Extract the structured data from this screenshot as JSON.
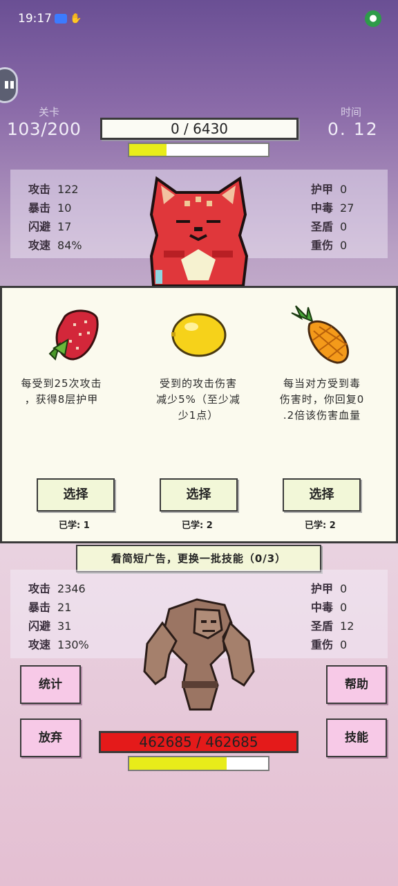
{
  "status_bar": {
    "time": "19:17"
  },
  "level": {
    "label": "关卡",
    "value": "103/200"
  },
  "time_display": {
    "label": "时间",
    "value": "0. 12"
  },
  "enemy": {
    "hp_text": "0  /  6430",
    "bar_fraction": 0.27,
    "stats_left": [
      {
        "label": "攻击",
        "value": "122"
      },
      {
        "label": "暴击",
        "value": "10"
      },
      {
        "label": "闪避",
        "value": "17"
      },
      {
        "label": "攻速",
        "value": "84%"
      }
    ],
    "stats_right": [
      {
        "label": "护甲",
        "value": "0"
      },
      {
        "label": "中毒",
        "value": "27"
      },
      {
        "label": "圣盾",
        "value": "0"
      },
      {
        "label": "重伤",
        "value": "0"
      }
    ]
  },
  "skills": [
    {
      "icon": "strawberry-icon",
      "desc_lines": [
        "每受到25次攻击",
        "，获得8层护甲"
      ],
      "button": "选择",
      "learned": "已学: 1"
    },
    {
      "icon": "lemon-icon",
      "desc_lines": [
        "受到的攻击伤害",
        "减少5%（至少减",
        "少1点）"
      ],
      "button": "选择",
      "learned": "已学: 2"
    },
    {
      "icon": "pineapple-icon",
      "desc_lines": [
        "每当对方受到毒",
        "伤害时，你回复0",
        ".2倍该伤害血量"
      ],
      "button": "选择",
      "learned": "已学: 2"
    }
  ],
  "reroll_label": "看简短广告，更换一批技能（0/3）",
  "player": {
    "stats_left": [
      {
        "label": "攻击",
        "value": "2346"
      },
      {
        "label": "暴击",
        "value": "21"
      },
      {
        "label": "闪避",
        "value": "31"
      },
      {
        "label": "攻速",
        "value": "130%"
      }
    ],
    "stats_right": [
      {
        "label": "护甲",
        "value": "0"
      },
      {
        "label": "中毒",
        "value": "0"
      },
      {
        "label": "圣盾",
        "value": "12"
      },
      {
        "label": "重伤",
        "value": "0"
      }
    ],
    "hp_text": "462685  /  462685",
    "bar_fraction": 0.7
  },
  "buttons": {
    "stats": "统计",
    "help": "帮助",
    "give_up": "放弃",
    "skills": "技能"
  }
}
